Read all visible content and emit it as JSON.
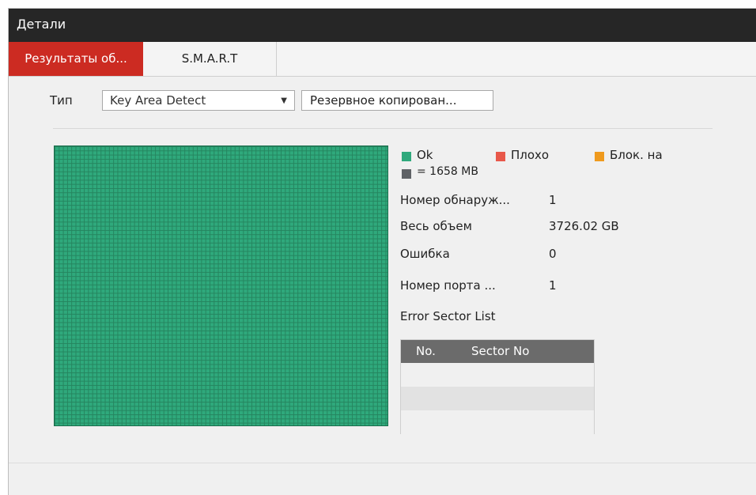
{
  "window": {
    "title": "Детали"
  },
  "tabs": [
    {
      "label": "Результаты об...",
      "active": true
    },
    {
      "label": "S.M.A.R.T",
      "active": false
    }
  ],
  "toolbar": {
    "type_label": "Тип",
    "type_value": "Key Area Detect",
    "backup_button": "Резервное копирован..."
  },
  "legend": {
    "ok": {
      "label": "Ok",
      "color": "#2fa97c"
    },
    "bad": {
      "label": "Плохо",
      "color": "#e8584a"
    },
    "blocked": {
      "label": "Блок. на",
      "color": "#ef9a1e"
    },
    "unit": {
      "label": "= 1658 MB",
      "color": "#5f6266"
    }
  },
  "info": [
    {
      "label": "Номер обнаруж...",
      "value": "1"
    },
    {
      "label": "Весь объем",
      "value": "3726.02 GB"
    },
    {
      "label": "Ошибка",
      "value": "0"
    },
    {
      "label": "Номер порта ...",
      "value": "1"
    }
  ],
  "error_list": {
    "title": "Error Sector List",
    "columns": [
      "No.",
      "Sector No"
    ],
    "rows": []
  },
  "disk_map": {
    "status": "Ok"
  }
}
